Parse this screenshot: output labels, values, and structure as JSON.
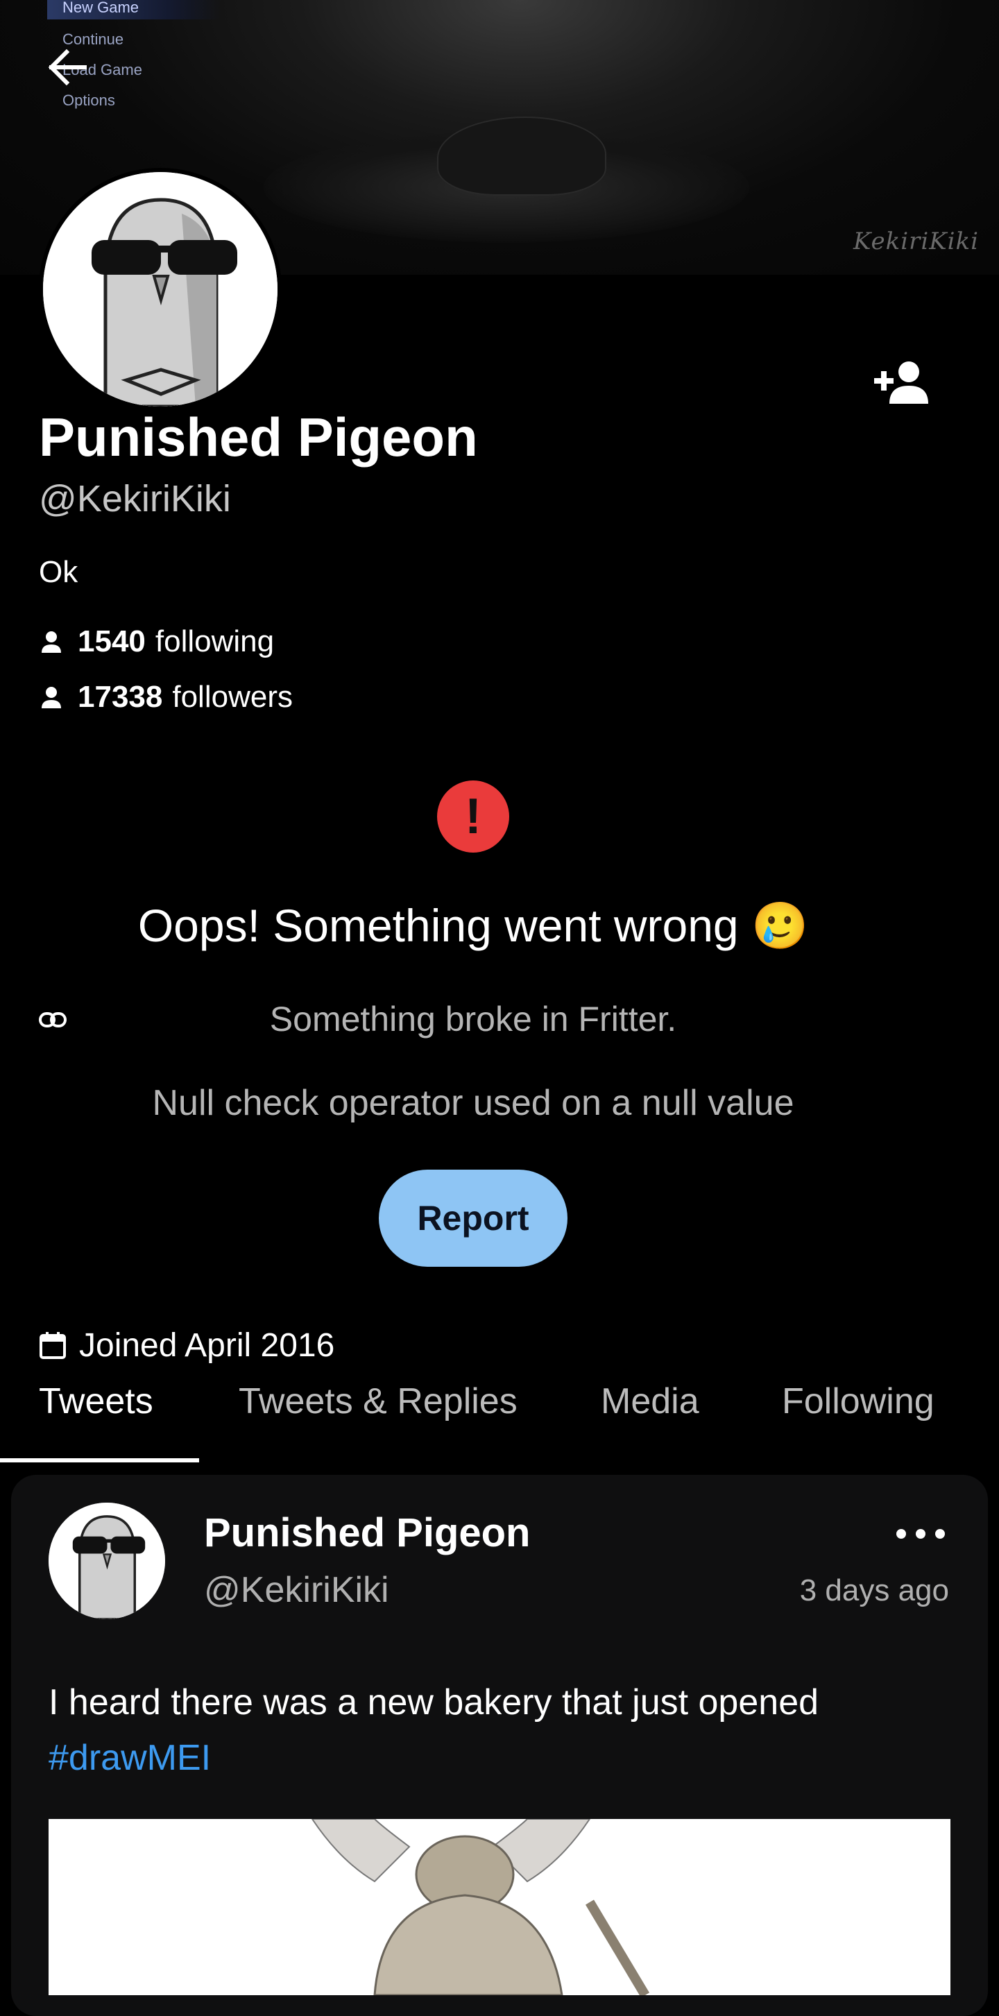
{
  "banner": {
    "menu_items": [
      "New Game",
      "Continue",
      "Load Game",
      "Options"
    ],
    "watermark": "KekiriKiki"
  },
  "profile": {
    "display_name": "Punished Pigeon",
    "handle": "@KekiriKiki",
    "bio": "Ok",
    "following_count": "1540",
    "following_label": "following",
    "followers_count": "17338",
    "followers_label": "followers",
    "joined": "Joined April 2016"
  },
  "error": {
    "icon_text": "!",
    "title": "Oops! Something went wrong 🥲",
    "subtitle": "Something broke in Fritter.",
    "detail": "Null check operator used on a null value",
    "report_label": "Report",
    "icon_color": "#ea3b3b",
    "button_color": "#8ec5f4"
  },
  "tabs": [
    {
      "label": "Tweets",
      "active": true
    },
    {
      "label": "Tweets & Replies",
      "active": false
    },
    {
      "label": "Media",
      "active": false
    },
    {
      "label": "Following",
      "active": false
    }
  ],
  "tweet": {
    "name": "Punished Pigeon",
    "handle": "@KekiriKiki",
    "time": "3 days ago",
    "text": "I heard there was a new bakery that just opened",
    "hashtag": "#drawMEI",
    "hashtag_color": "#3d9af0"
  },
  "icons": [
    "back-arrow-icon",
    "follow-add-icon",
    "person-icon",
    "link-icon",
    "calendar-icon",
    "more-horizontal-icon",
    "error-icon"
  ]
}
